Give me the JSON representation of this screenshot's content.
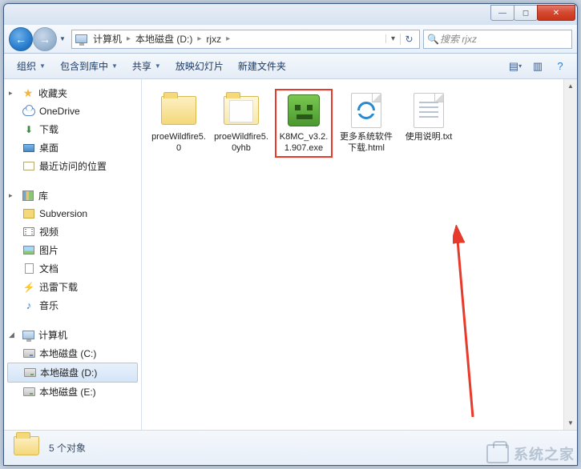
{
  "titlebar": {
    "min": "—",
    "max": "◻",
    "close": "✕"
  },
  "nav": {
    "back": "←",
    "forward": "→",
    "dropdown": "▼",
    "breadcrumb": [
      "计算机",
      "本地磁盘 (D:)",
      "rjxz"
    ],
    "sep": "▸",
    "addr_dropdown": "▾",
    "refresh": "↻"
  },
  "search": {
    "placeholder": "搜索 rjxz",
    "icon": "🔍"
  },
  "toolbar": {
    "organize": "组织",
    "include": "包含到库中",
    "share": "共享",
    "slideshow": "放映幻灯片",
    "new_folder": "新建文件夹",
    "dropdown": "▼",
    "view_icon": "▤",
    "view_drop": "▾",
    "help_icon": "?"
  },
  "sidebar": {
    "favorites": {
      "label": "收藏夹",
      "caret": "▸",
      "items": [
        {
          "label": "OneDrive",
          "icon": "cloud"
        },
        {
          "label": "下载",
          "icon": "download"
        },
        {
          "label": "桌面",
          "icon": "desktop"
        },
        {
          "label": "最近访问的位置",
          "icon": "recent"
        }
      ]
    },
    "libraries": {
      "label": "库",
      "caret": "▸",
      "items": [
        {
          "label": "Subversion",
          "icon": "svn"
        },
        {
          "label": "视频",
          "icon": "video"
        },
        {
          "label": "图片",
          "icon": "pic"
        },
        {
          "label": "文档",
          "icon": "doc"
        },
        {
          "label": "迅雷下载",
          "icon": "thunder"
        },
        {
          "label": "音乐",
          "icon": "music"
        }
      ]
    },
    "computer": {
      "label": "计算机",
      "caret": "◢",
      "items": [
        {
          "label": "本地磁盘 (C:)",
          "icon": "disk-c"
        },
        {
          "label": "本地磁盘 (D:)",
          "icon": "disk",
          "selected": true
        },
        {
          "label": "本地磁盘 (E:)",
          "icon": "disk"
        }
      ]
    }
  },
  "files": [
    {
      "name": "proeWildfire5.0",
      "type": "folder"
    },
    {
      "name": "proeWildfire5.0yhb",
      "type": "folder-open"
    },
    {
      "name": "K8MC_v3.2.1.907.exe",
      "type": "exe",
      "highlighted": true
    },
    {
      "name": "更多系统软件下载.html",
      "type": "html"
    },
    {
      "name": "使用说明.txt",
      "type": "txt"
    }
  ],
  "status": {
    "text": "5 个对象"
  },
  "watermark": "系统之家"
}
